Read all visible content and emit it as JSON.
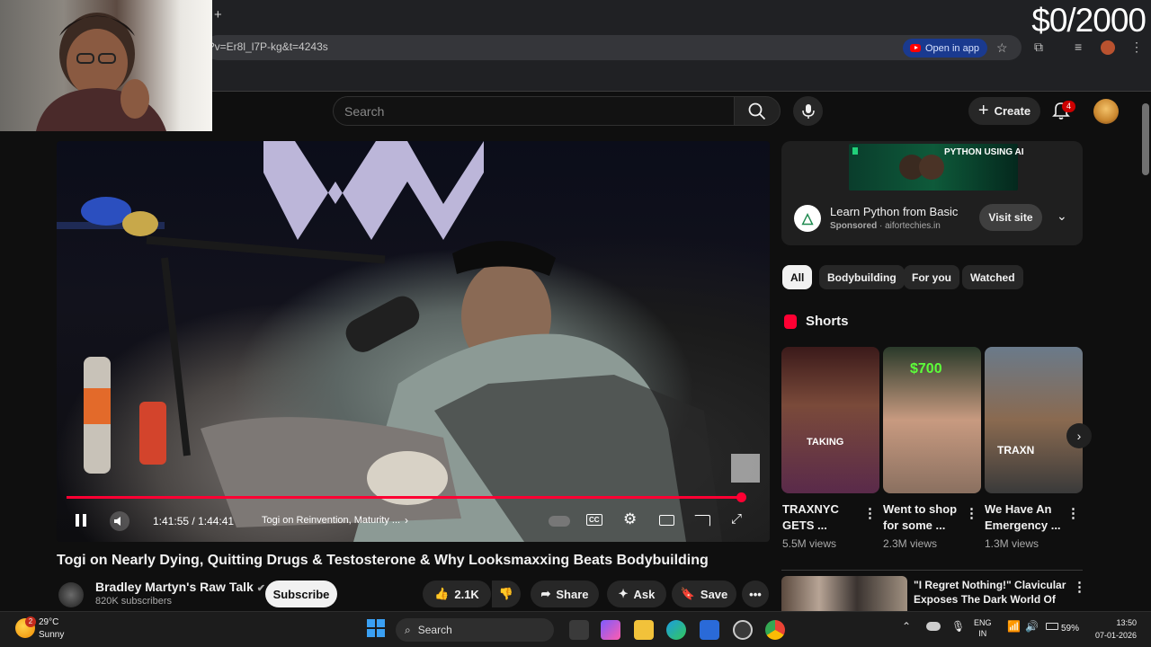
{
  "browser": {
    "url_fragment": "?v=Er8l_l7P-kg&t=4243s",
    "open_in_app_label": "Open in app",
    "new_tab_symbol": "+"
  },
  "overlay": {
    "cost_counter": "$0/2000"
  },
  "header": {
    "search_placeholder": "Search",
    "create_label": "Create",
    "notification_count": "4"
  },
  "player": {
    "time_current": "1:41:55",
    "time_separator": " / ",
    "time_total": "1:44:41",
    "chapter_title": "Togi on Reinvention, Maturity ...",
    "progress_fraction": 0.974
  },
  "video": {
    "title": "Togi on Nearly Dying, Quitting Drugs & Testosterone & Why Looksmaxxing Beats Bodybuilding",
    "channel_name": "Bradley Martyn's Raw Talk",
    "subscribers": "820K subscribers",
    "subscribe_label": "Subscribe",
    "likes": "2.1K",
    "share_label": "Share",
    "ask_label": "Ask",
    "save_label": "Save"
  },
  "ad": {
    "banner_text": "PYTHON USING AI",
    "title": "Learn Python from Basic",
    "sponsored_label": "Sponsored",
    "domain": "aifortechies.in",
    "visit_label": "Visit site"
  },
  "chips": [
    "All",
    "Bodybuilding",
    "For you",
    "Watched"
  ],
  "shorts": {
    "section_title": "Shorts",
    "items": [
      {
        "title_line1": "TRAXNYC",
        "title_line2": "GETS ...",
        "views": "5.5M views",
        "overlay": "TAKING"
      },
      {
        "title_line1": "Went to shop",
        "title_line2": "for some ...",
        "views": "2.3M views",
        "overlay": "$700"
      },
      {
        "title_line1": "We Have An",
        "title_line2": "Emergency ...",
        "views": "1.3M views",
        "overlay": "TRAXN"
      }
    ]
  },
  "recommendation": {
    "title_line1": "\"I Regret Nothing!\" Clavicular",
    "title_line2": "Exposes The Dark World Of ..."
  },
  "taskbar": {
    "temperature": "29°C",
    "condition": "Sunny",
    "weather_badge": "2",
    "search_label": "Search",
    "lang_line1": "ENG",
    "lang_line2": "IN",
    "battery": "59%",
    "time": "13:50",
    "date": "07-01-2026"
  }
}
